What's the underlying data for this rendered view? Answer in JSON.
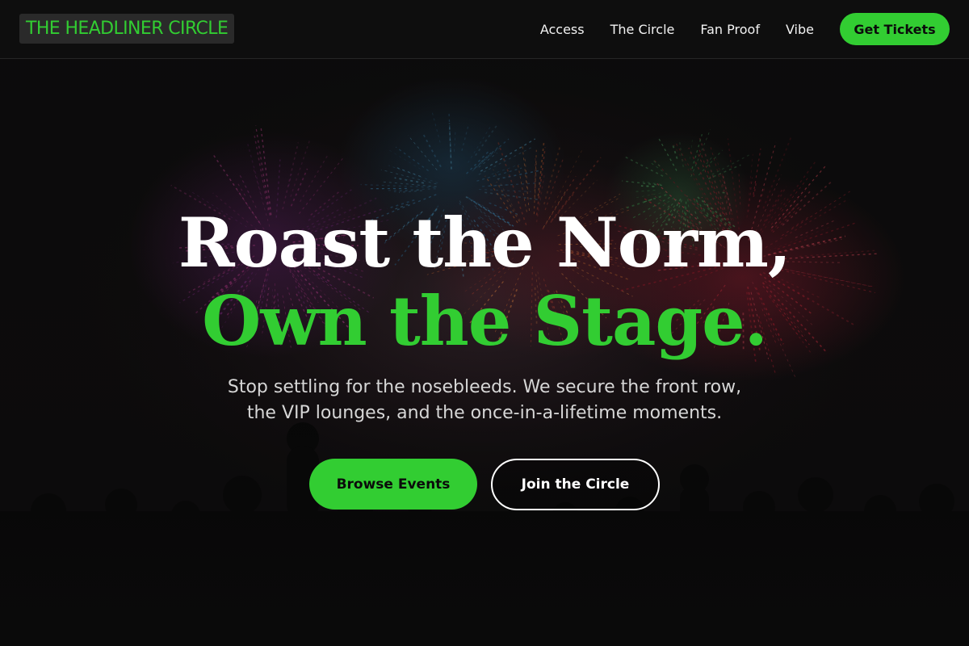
{
  "brand": {
    "name": "THE HEADLINER CIRCLE"
  },
  "nav": {
    "links": [
      "Access",
      "The Circle",
      "Fan Proof",
      "Vibe"
    ],
    "cta_label": "Get Tickets"
  },
  "hero": {
    "headline_line1": "Roast the Norm,",
    "headline_line2": "Own the Stage.",
    "subtext_line1": "Stop settling for the nosebleeds. We secure the front row,",
    "subtext_line2": "the VIP lounges, and the once-in-a-lifetime moments.",
    "primary_button": "Browse Events",
    "secondary_button": "Join the Circle"
  },
  "colors": {
    "accent": "#32cd32",
    "background": "#0b0b0b",
    "header": "#0e0e0e",
    "text": "#ffffff"
  },
  "icons": {
    "background_image": "fireworks-concert-crowd-image"
  }
}
